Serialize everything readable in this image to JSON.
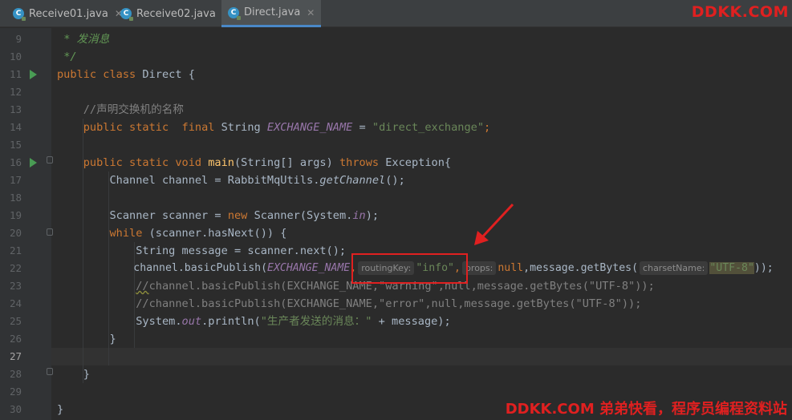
{
  "tabs": [
    {
      "label": "Receive01.java",
      "icon": "java-class-icon",
      "close": "✕"
    },
    {
      "label": "Receive02.java",
      "icon": "java-class-icon",
      "close": "✕"
    },
    {
      "label": "Direct.java",
      "icon": "java-class-icon",
      "close": "✕",
      "active": true
    }
  ],
  "watermark_top": "DDKK.COM",
  "watermark_bottom": "DDKK.COM 弟弟快看，程序员编程资料站",
  "gutter": [
    "9",
    "10",
    "11",
    "12",
    "13",
    "14",
    "15",
    "16",
    "17",
    "18",
    "19",
    "20",
    "21",
    "22",
    "23",
    "24",
    "25",
    "26",
    "27",
    "28",
    "29",
    "30"
  ],
  "code": {
    "l9_doc": "* 发消息",
    "l10_doc": "*/",
    "l11_kw": "public class ",
    "l11_name": "Direct {",
    "l13_com": "//声明交换机的名称",
    "l14_kw": "public static  final ",
    "l14_type": "String ",
    "l14_field": "EXCHANGE_NAME",
    "l14_eq": " = ",
    "l14_str": "\"direct_exchange\"",
    "l14_semi": ";",
    "l16_kw": "public static void ",
    "l16_fn": "main",
    "l16_args": "(String[] args) ",
    "l16_throws": "throws ",
    "l16_exc": "Exception{",
    "l17_a": "Channel channel = RabbitMqUtils.",
    "l17_b": "getChannel",
    "l17_c": "();",
    "l19_a": "Scanner scanner = ",
    "l19_new": "new ",
    "l19_b": "Scanner(System.",
    "l19_in": "in",
    "l19_c": ");",
    "l20_while": "while ",
    "l20_a": "(scanner.hasNext()) {",
    "l21": "String message = scanner.next();",
    "l22_a": "channel.basicPublish(",
    "l22_field": "EXCHANGE_NAME",
    "l22_comma1": ",",
    "l22_hint1": "routingKey:",
    "l22_str1": "\"info\"",
    "l22_comma2": ",",
    "l22_hint2": "props:",
    "l22_null": "null",
    "l22_b": ",message.getBytes(",
    "l22_hint3": "charsetName:",
    "l22_str2": "\"UTF-8\"",
    "l22_c": "));",
    "l23_slashes": "//",
    "l23_rest": "channel.basicPublish(EXCHANGE_NAME,\"warning\",null,message.getBytes(\"UTF-8\"));",
    "l24": "//channel.basicPublish(EXCHANGE_NAME,\"error\",null,message.getBytes(\"UTF-8\"));",
    "l25_a": "System.",
    "l25_out": "out",
    "l25_b": ".println(",
    "l25_str": "\"生产者发送的消息：\"",
    "l25_c": " + message);",
    "l26": "}",
    "l28": "}",
    "l30": "}"
  },
  "colors": {
    "annotation": "#e02020",
    "keyword": "#cc7832",
    "string": "#6a8759",
    "field": "#9876aa"
  }
}
